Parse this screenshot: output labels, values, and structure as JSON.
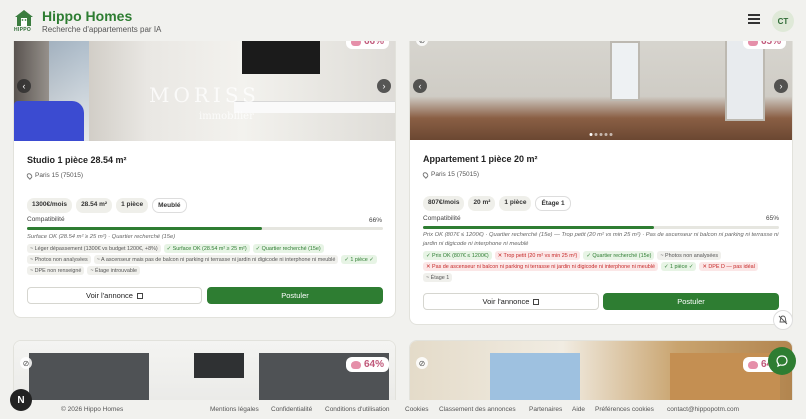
{
  "header": {
    "logo_text": "HIPPO",
    "brand": "Hippo Homes",
    "tagline": "Recherche d'appartements par IA",
    "avatar_initials": "CT"
  },
  "cards": [
    {
      "score": "66%",
      "photo_overlay": "MORISS",
      "photo_overlay_sub": "immobilier",
      "title": "Studio 1 pièce 28.54 m²",
      "location": "Paris 15 (75015)",
      "chips": [
        "1300€/mois",
        "28.54 m²",
        "1 pièce",
        "Meublé"
      ],
      "compat_label": "Compatibilité",
      "compat_pct": "66%",
      "compat_value": 0.66,
      "summary": "Surface OK (28.54 m² ≥ 25 m²) · Quartier recherché (15e)",
      "tags": [
        {
          "text": "~ Léger dépassement (1300€ vs budget 1200€, +8%)",
          "kind": "neutral"
        },
        {
          "text": "✓ Surface OK (28.54 m² ≥ 25 m²)",
          "kind": "green"
        },
        {
          "text": "✓ Quartier recherché (15e)",
          "kind": "green"
        },
        {
          "text": "~ Photos non analysées",
          "kind": "neutral"
        },
        {
          "text": "~ A ascenseur mais pas de balcon ni parking ni terrasse ni jardin ni digicode ni interphone ni meublé",
          "kind": "neutral"
        },
        {
          "text": "✓ 1 pièce ✓",
          "kind": "green"
        },
        {
          "text": "~ DPE non renseigné",
          "kind": "neutral"
        },
        {
          "text": "~ Étage introuvable",
          "kind": "neutral"
        }
      ],
      "view_label": "Voir l'annonce",
      "apply_label": "Postuler"
    },
    {
      "score": "65%",
      "title": "Appartement 1 pièce 20 m²",
      "location": "Paris 15 (75015)",
      "chips": [
        "807€/mois",
        "20 m²",
        "1 pièce",
        "Étage 1"
      ],
      "compat_label": "Compatibilité",
      "compat_pct": "65%",
      "compat_value": 0.65,
      "summary": "Prix OK (807€ ≤ 1200€) · Quartier recherché (15e) — Trop petit (20 m² vs min 25 m²) · Pas de ascenseur ni balcon ni parking ni terrasse ni jardin ni digicode ni interphone ni meublé",
      "tags": [
        {
          "text": "✓ Prix OK (807€ ≤ 1200€)",
          "kind": "green"
        },
        {
          "text": "✕ Trop petit (20 m² vs min 25 m²)",
          "kind": "red"
        },
        {
          "text": "✓ Quartier recherché (15e)",
          "kind": "green"
        },
        {
          "text": "~ Photos non analysées",
          "kind": "neutral"
        },
        {
          "text": "✕ Pas de ascenseur ni balcon ni parking ni terrasse ni jardin ni digicode ni interphone ni meublé",
          "kind": "red"
        },
        {
          "text": "✓ 1 pièce ✓",
          "kind": "green"
        },
        {
          "text": "✕ DPE D — pas idéal",
          "kind": "red"
        },
        {
          "text": "~ Étage 1",
          "kind": "neutral"
        }
      ],
      "view_label": "Voir l'annonce",
      "apply_label": "Postuler"
    },
    {
      "score": "64%"
    },
    {
      "score": "64%"
    }
  ],
  "footer": {
    "copyright": "© 2026 Hippo Homes",
    "links": [
      "Mentions légales",
      "Confidentialité",
      "Conditions d'utilisation",
      "Cookies",
      "Classement des annonces",
      "Partenaires",
      "Aide",
      "Préférences cookies",
      "contact@hippopotm.com"
    ]
  },
  "fab": {
    "n_label": "N"
  }
}
